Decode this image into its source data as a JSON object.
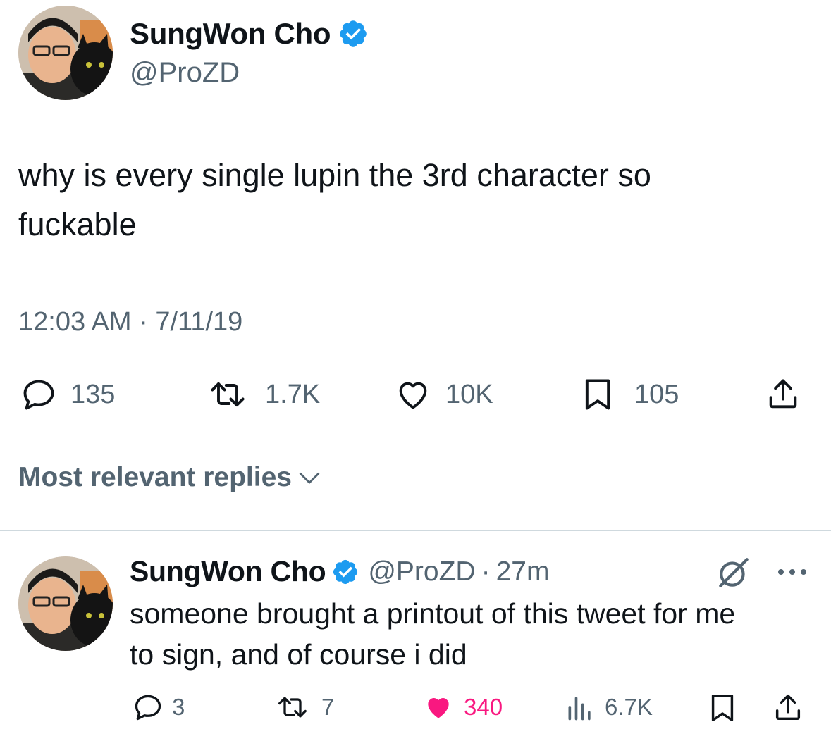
{
  "tweet": {
    "author_name": "SungWon Cho",
    "author_handle": "@ProZD",
    "text_line1": "why is every single lupin the 3rd character so",
    "text_line2": "fuckable",
    "timestamp": "12:03 AM · 7/11/19",
    "metrics": {
      "replies": "135",
      "retweets": "1.7K",
      "likes": "10K",
      "bookmarks": "105"
    }
  },
  "replies_header": {
    "label": "Most relevant replies"
  },
  "reply": {
    "author_name": "SungWon Cho",
    "author_handle": "@ProZD",
    "separator": "·",
    "time": "27m",
    "text_line1": "someone brought a printout of this tweet for me",
    "text_line2": "to sign, and of course i did",
    "metrics": {
      "replies": "3",
      "retweets": "7",
      "likes": "340",
      "views": "6.7K"
    }
  },
  "colors": {
    "verified": "#1d9bf0",
    "secondary_text": "#536471",
    "like_active": "#f91880"
  },
  "icons": [
    "verified-badge-icon",
    "reply-icon",
    "retweet-icon",
    "like-icon",
    "bookmark-icon",
    "share-icon",
    "views-icon",
    "grok-icon",
    "more-icon",
    "chevron-down-icon"
  ]
}
